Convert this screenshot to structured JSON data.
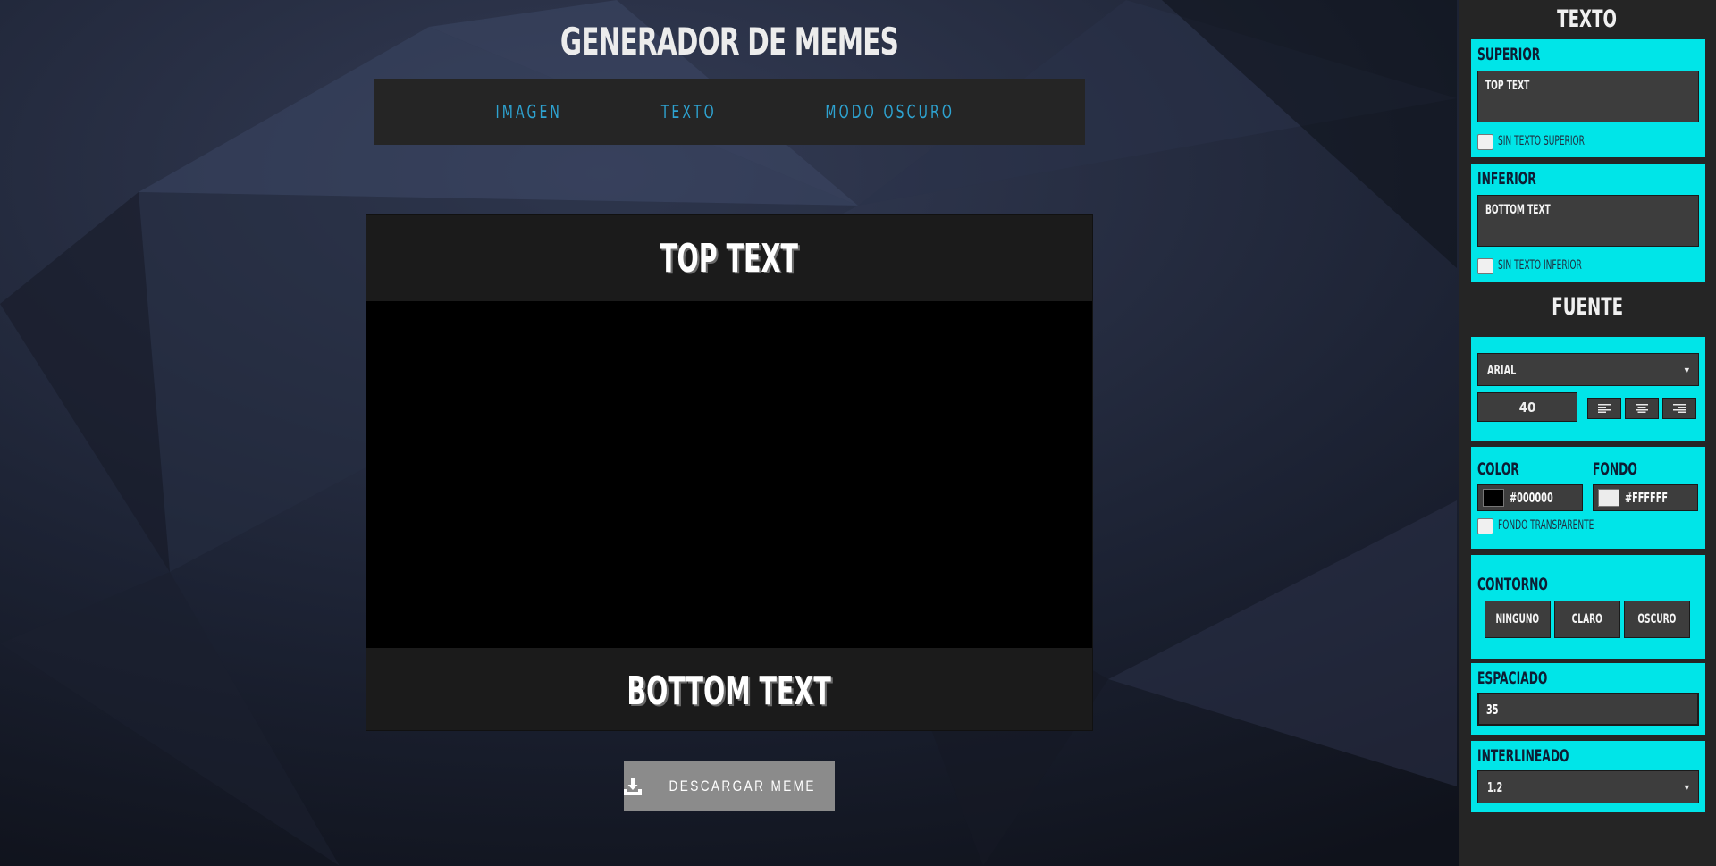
{
  "app": {
    "title": "GENERADOR DE MEMES"
  },
  "nav": {
    "items": [
      "IMAGEN",
      "TEXTO",
      "MODO OSCURO"
    ]
  },
  "meme": {
    "top_text": "TOP TEXT",
    "bottom_text": "BOTTOM TEXT"
  },
  "download": {
    "label": "DESCARGAR MEME",
    "icon": "download-icon"
  },
  "panel": {
    "text_heading": "TEXTO",
    "top": {
      "label": "SUPERIOR",
      "value": "TOP TEXT",
      "checkbox_label": "SIN TEXTO SUPERIOR",
      "checked": false
    },
    "bottom": {
      "label": "INFERIOR",
      "value": "BOTTOM TEXT",
      "checkbox_label": "SIN TEXTO INFERIOR",
      "checked": false
    },
    "font_heading": "FUENTE",
    "font": {
      "family": "ARIAL",
      "size": "40",
      "align_icons": [
        "align-left-icon",
        "align-center-icon",
        "align-right-icon"
      ]
    },
    "colors": {
      "color_label": "COLOR",
      "color_value": "#000000",
      "bg_label": "FONDO",
      "bg_value": "#FFFFFF",
      "transparent_label": "FONDO TRANSPARENTE",
      "transparent_checked": false,
      "color_swatch": "#000000",
      "bg_swatch": "#ececec"
    },
    "outline": {
      "label": "CONTORNO",
      "buttons": [
        "NINGUNO",
        "CLARO",
        "OSCURO"
      ]
    },
    "spacing": {
      "label": "ESPACIADO",
      "value": "35"
    },
    "line_height": {
      "label": "INTERLINEADO",
      "value": "1.2"
    }
  },
  "theme": {
    "accent": "#00e5e8",
    "nav_link": "#2ea3d1",
    "panel_bg": "#252525",
    "bg": "#1b2030"
  }
}
